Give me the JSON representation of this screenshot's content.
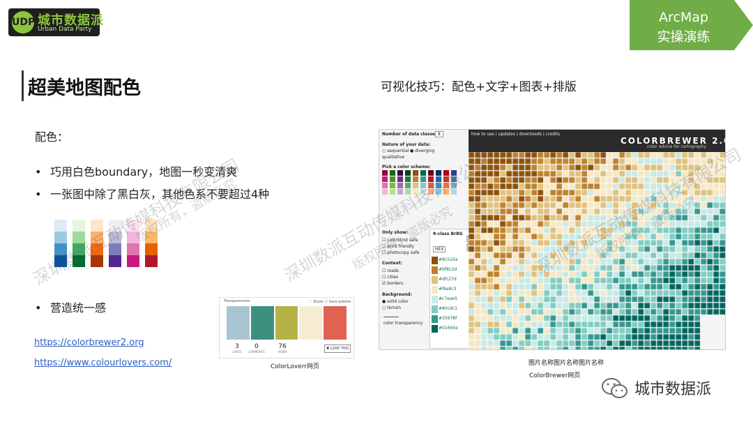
{
  "logo": {
    "badge": "UDP",
    "cn": "城市数据派",
    "en": "Urban Data Party"
  },
  "tag": {
    "line1": "ArcMap",
    "line2": "实操演练"
  },
  "title": "超美地图配色",
  "subtitle": "可视化技巧：配色+文字+图表+排版",
  "section_label": "配色：",
  "bullets": [
    "巧用白色boundary，地图一秒变清爽",
    "一张图中除了黑白灰，其他色系不要超过4种",
    "营造统一感"
  ],
  "bullet_symbol": "•",
  "links": [
    "https://colorbrewer2.org",
    "https://www.colourlovers.com/"
  ],
  "palette_columns": [
    [
      "#deebf7",
      "#9ecae1",
      "#4292c6",
      "#08519c"
    ],
    [
      "#e5f5e0",
      "#a1d99b",
      "#41ab5d",
      "#006d2c"
    ],
    [
      "#fee6ce",
      "#fdae6b",
      "#f16913",
      "#a63603"
    ],
    [
      "#efedf5",
      "#bcbddc",
      "#807dba",
      "#54278f"
    ],
    [
      "#fde0ef",
      "#f1b6da",
      "#de77ae",
      "#c51b7d"
    ],
    [
      "#fee0b6",
      "#fdb863",
      "#e66101",
      "#b2182b"
    ]
  ],
  "colourlovers": {
    "header_left": "Transparencies",
    "header_right": "♡ Share   ⓘ Save palette",
    "colors": [
      "#a8c4d0",
      "#3d8f80",
      "#b5b345",
      "#f5ecd2",
      "#e06352"
    ],
    "stats": [
      {
        "value": "3",
        "label": "LOVES"
      },
      {
        "value": "0",
        "label": "COMMENTS"
      },
      {
        "value": "76",
        "label": "VIEWS"
      }
    ],
    "button": "♥ LOVE THIS",
    "caption": "ColorLoverr网页"
  },
  "colorbrewer": {
    "classes_label": "Number of data classes:",
    "classes_value": "8",
    "nature_label": "Nature of your data:",
    "nature_options": [
      "sequential",
      "diverging",
      "qualitative"
    ],
    "scheme_label": "Pick a color scheme:",
    "show_label": "Only show:",
    "show_options": [
      "colorblind safe",
      "print friendly",
      "photocopy safe"
    ],
    "context_label": "Context:",
    "context_options": [
      "roads",
      "cities",
      "borders"
    ],
    "background_label": "Background:",
    "background_options": [
      "solid color",
      "terrain"
    ],
    "transparency_label": "color transparency",
    "class_title": "8-class BrBG",
    "format": "HEX",
    "export_label": "EXPORT",
    "hex_values": [
      "#8c510a",
      "#bf812d",
      "#dfc27d",
      "#f6e8c3",
      "#c7eae5",
      "#80cdc1",
      "#35978f",
      "#01665e"
    ],
    "nav": "how to use  |  updates  |  downloads  |  credits",
    "logo": "COLORBREWER 2.0",
    "logo_sub": "color advice for cartography",
    "caption1": "图片名称图片名称图片名称",
    "caption2": "ColorBrewer网页"
  },
  "watermarks": [
    "深圳数派互动传媒科技有限公司",
    "版权所有，盗版必究",
    "www.udparty.com"
  ],
  "wechat": "城市数据派"
}
